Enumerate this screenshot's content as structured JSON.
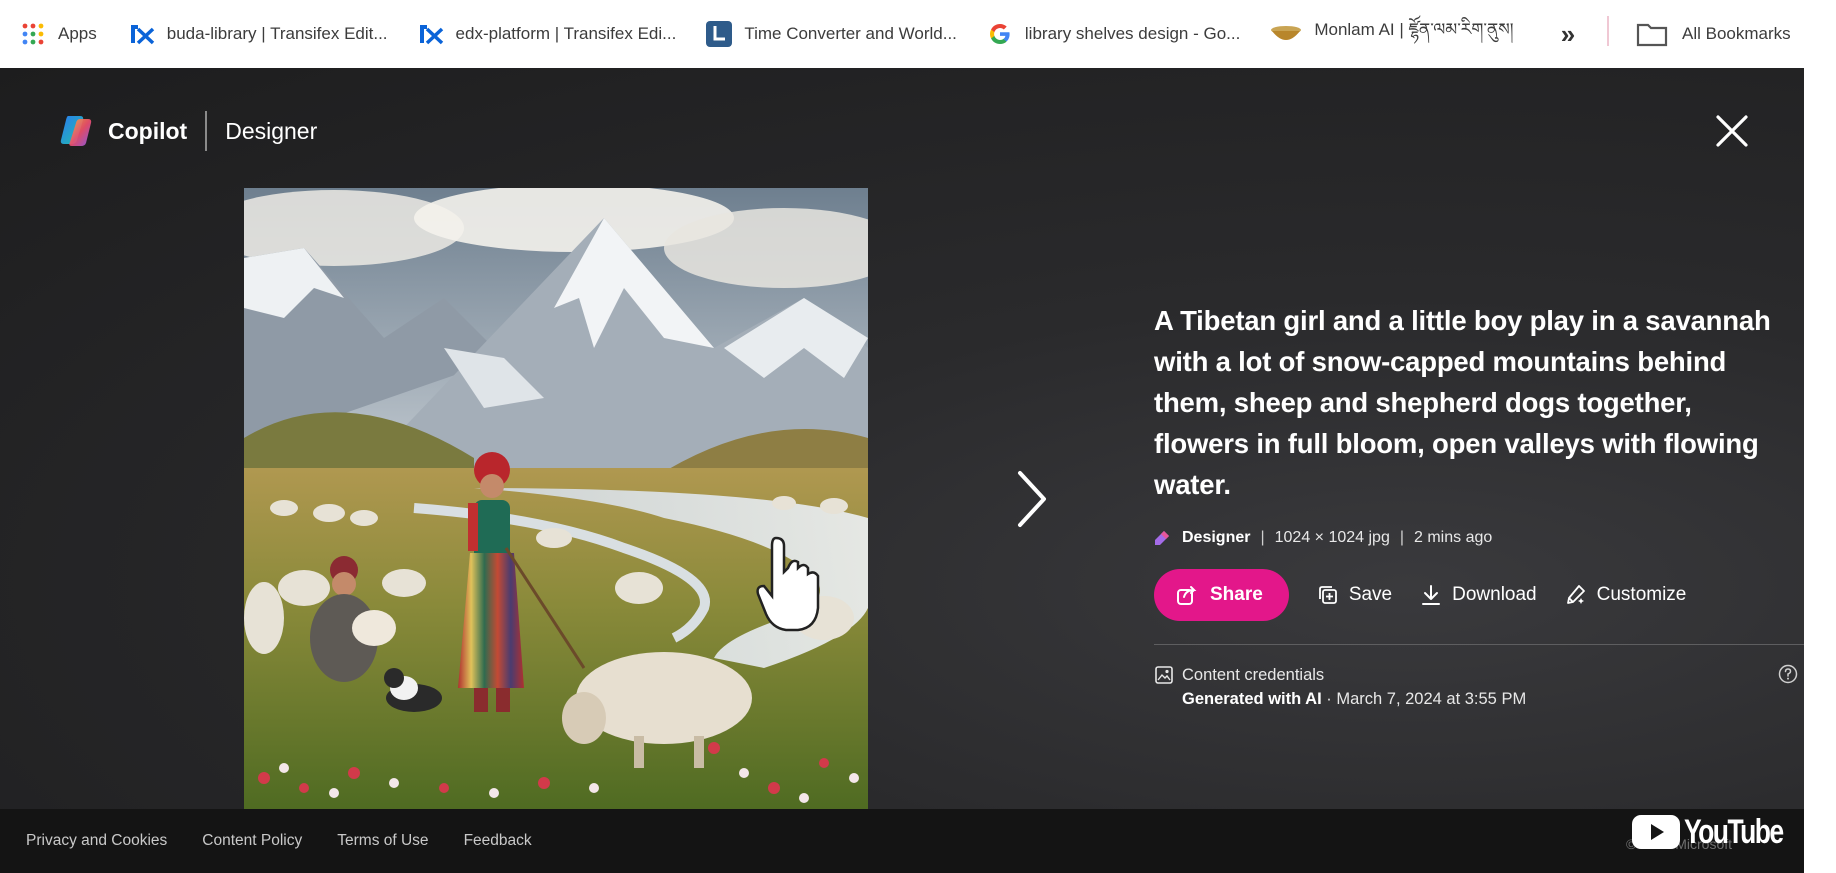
{
  "bookmarks_bar": {
    "items": [
      {
        "label": "Apps",
        "icon": "apps-grid-icon"
      },
      {
        "label": "buda-library | Transifex Edit...",
        "icon": "transifex-icon"
      },
      {
        "label": "edx-platform | Transifex Edi...",
        "icon": "transifex-icon"
      },
      {
        "label": "Time Converter and World...",
        "icon": "time-converter-icon"
      },
      {
        "label": "library shelves design - Go...",
        "icon": "google-icon"
      },
      {
        "label": "Monlam AI | ཛྷོན་ལམ་རིག་ནུས།",
        "icon": "monlam-icon"
      }
    ],
    "more_label": "»",
    "all_bookmarks_label": "All Bookmarks"
  },
  "header": {
    "brand": "Copilot",
    "product": "Designer",
    "close_icon": "close-icon"
  },
  "image": {
    "subject": "generated-artwork",
    "next_icon": "chevron-right-icon"
  },
  "details": {
    "prompt": "A Tibetan girl and a little boy play in a savannah with a lot of snow-capped mountains behind them, sheep and shepherd dogs together, flowers in full bloom, open valleys with flowing water.",
    "meta": {
      "creator": "Designer",
      "separator": "|",
      "dimensions": "1024 × 1024 jpg",
      "age": "2 mins ago"
    },
    "actions": {
      "share": "Share",
      "save": "Save",
      "download": "Download",
      "customize": "Customize"
    },
    "credentials": {
      "title": "Content credentials",
      "generated": "Generated with AI",
      "date": " · March 7, 2024 at 3:55 PM"
    }
  },
  "footer": {
    "links": [
      "Privacy and Cookies",
      "Content Policy",
      "Terms of Use",
      "Feedback"
    ],
    "copyright": "© 2024 Microsoft",
    "watermark": "YouTube"
  },
  "colors": {
    "accent": "#e3178a",
    "background": "#1d1d1e",
    "footer": "#141414"
  }
}
